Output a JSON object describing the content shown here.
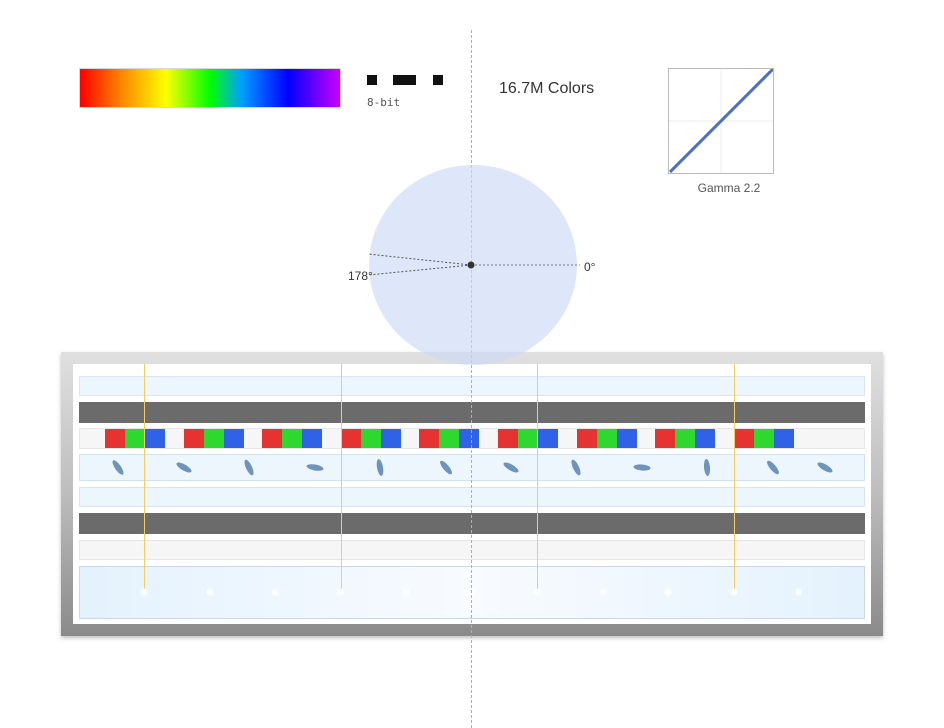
{
  "bit_depth": {
    "label": "8-bit"
  },
  "color_count": {
    "label": "16.7M Colors"
  },
  "gamma": {
    "label": "Gamma 2.2"
  },
  "viewing_angle": {
    "left_label": "178°",
    "right_label": "0°"
  },
  "colors": {
    "subpixel_red": "#e73232",
    "subpixel_green": "#2fd82f",
    "subpixel_blue": "#2f62e6",
    "liquid_crystal": "#6f94bb",
    "gamma_curve": "#4a6fc8",
    "light_guide_lines": "#f3cd60"
  },
  "subpixel_group_count": 9,
  "liquid_crystal_count": 12
}
